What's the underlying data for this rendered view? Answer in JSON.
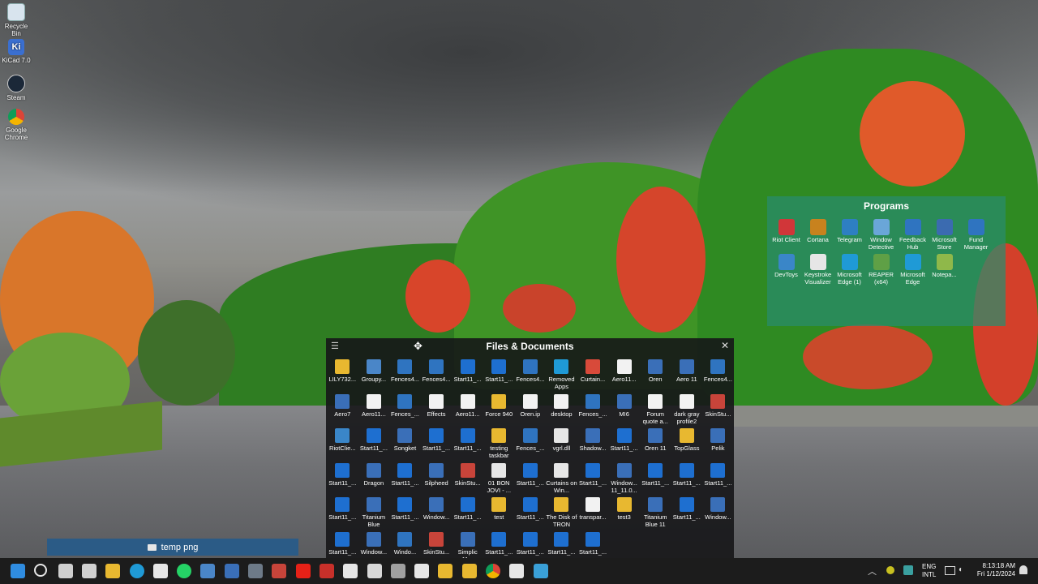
{
  "desktop_icons": [
    {
      "label": "Recycle Bin",
      "icon": "recycle-bin-icon",
      "color": "#d8e4ee"
    },
    {
      "label": "KiCad 7.0",
      "icon": "kicad-icon",
      "color": "#3a6fd0",
      "glyph": "Ki"
    },
    {
      "label": "Steam",
      "icon": "steam-icon",
      "color": "#1b2838"
    },
    {
      "label": "Google Chrome",
      "icon": "chrome-icon",
      "color": "#e0b020"
    }
  ],
  "programs": {
    "title": "Programs",
    "items": [
      {
        "label": "Riot Client",
        "color": "#d13639"
      },
      {
        "label": "Cortana",
        "color": "#c8821e"
      },
      {
        "label": "Telegram",
        "color": "#2e7fc2"
      },
      {
        "label": "Window Detective",
        "color": "#6aa6d8"
      },
      {
        "label": "Feedback Hub",
        "color": "#2f74c0"
      },
      {
        "label": "Microsoft Store",
        "color": "#3b6bb0"
      },
      {
        "label": "Fund Manager",
        "color": "#2f74c0"
      },
      {
        "label": "DevToys",
        "color": "#3a86c8"
      },
      {
        "label": "Keystroke Visualizer",
        "color": "#e6e6e6"
      },
      {
        "label": "Microsoft Edge (1)",
        "color": "#1f9ad6"
      },
      {
        "label": "REAPER (x64)",
        "color": "#5fa046"
      },
      {
        "label": "Microsoft Edge",
        "color": "#1f9ad6"
      },
      {
        "label": "Notepa...",
        "color": "#8fb84a"
      }
    ]
  },
  "files": {
    "title": "Files & Documents",
    "items": [
      {
        "label": "LILY732...",
        "color": "#e8b830"
      },
      {
        "label": "Groupy...",
        "color": "#4a86c8"
      },
      {
        "label": "Fences4...",
        "color": "#2f74c0"
      },
      {
        "label": "Fences4...",
        "color": "#2f74c0"
      },
      {
        "label": "Start11_...",
        "color": "#1e6fd0"
      },
      {
        "label": "Start11_...",
        "color": "#1e6fd0"
      },
      {
        "label": "Fences4...",
        "color": "#2f74c0"
      },
      {
        "label": "Removed Apps",
        "color": "#1f9ad6"
      },
      {
        "label": "Curtain...",
        "color": "#d84a3a"
      },
      {
        "label": "Aero11...",
        "color": "#f2f2f2"
      },
      {
        "label": "Oren",
        "color": "#3a6fb8"
      },
      {
        "label": "Aero 11",
        "color": "#3a6fb8"
      },
      {
        "label": "Fences4...",
        "color": "#2f74c0"
      },
      {
        "label": "Aero7",
        "color": "#3a6fb8"
      },
      {
        "label": "Aero11...",
        "color": "#f2f2f2"
      },
      {
        "label": "Fences_...",
        "color": "#2f74c0"
      },
      {
        "label": "Effects",
        "color": "#f2f2f2"
      },
      {
        "label": "Aero11...",
        "color": "#f2f2f2"
      },
      {
        "label": "Force 940",
        "color": "#e8b830"
      },
      {
        "label": "Oren.ip",
        "color": "#f2f2f2"
      },
      {
        "label": "desktop",
        "color": "#f2f2f2"
      },
      {
        "label": "Fences_...",
        "color": "#2f74c0"
      },
      {
        "label": "MI6",
        "color": "#3a6fb8"
      },
      {
        "label": "Forum quote a...",
        "color": "#f2f2f2"
      },
      {
        "label": "dark gray profile2",
        "color": "#f2f2f2"
      },
      {
        "label": "SkinStu...",
        "color": "#c8443a"
      },
      {
        "label": "RiotClie...",
        "color": "#3a86c8"
      },
      {
        "label": "Start11_...",
        "color": "#1e6fd0"
      },
      {
        "label": "Songket",
        "color": "#3a6fb8"
      },
      {
        "label": "Start11_...",
        "color": "#1e6fd0"
      },
      {
        "label": "Start11_...",
        "color": "#1e6fd0"
      },
      {
        "label": "testing taskbar",
        "color": "#e8b830"
      },
      {
        "label": "Fences_...",
        "color": "#2f74c0"
      },
      {
        "label": "vgrl.dll",
        "color": "#e6e6e6"
      },
      {
        "label": "Shadow...",
        "color": "#3a6fb8"
      },
      {
        "label": "Start11_...",
        "color": "#1e6fd0"
      },
      {
        "label": "Oren 11",
        "color": "#3a6fb8"
      },
      {
        "label": "TopGlass",
        "color": "#e8b830"
      },
      {
        "label": "Pelik",
        "color": "#3a6fb8"
      },
      {
        "label": "Start11_...",
        "color": "#1e6fd0"
      },
      {
        "label": "Dragon",
        "color": "#3a6fb8"
      },
      {
        "label": "Start11_...",
        "color": "#1e6fd0"
      },
      {
        "label": "Silpheed",
        "color": "#3a6fb8"
      },
      {
        "label": "SkinStu...",
        "color": "#c8443a"
      },
      {
        "label": "01 BON JOVI - ...",
        "color": "#e6e6e6"
      },
      {
        "label": "Start11_...",
        "color": "#1e6fd0"
      },
      {
        "label": "Curtains on Win...",
        "color": "#e6e6e6"
      },
      {
        "label": "Start11_...",
        "color": "#1e6fd0"
      },
      {
        "label": "Window... 11_11.0...",
        "color": "#3a6fb8"
      },
      {
        "label": "Start11_...",
        "color": "#1e6fd0"
      },
      {
        "label": "Start11_...",
        "color": "#1e6fd0"
      },
      {
        "label": "Start11_...",
        "color": "#1e6fd0"
      },
      {
        "label": "Start11_...",
        "color": "#1e6fd0"
      },
      {
        "label": "Titanium Blue",
        "color": "#3a6fb8"
      },
      {
        "label": "Start11_...",
        "color": "#1e6fd0"
      },
      {
        "label": "Window...",
        "color": "#3a6fb8"
      },
      {
        "label": "Start11_...",
        "color": "#1e6fd0"
      },
      {
        "label": "test",
        "color": "#e8b830"
      },
      {
        "label": "Start11_...",
        "color": "#1e6fd0"
      },
      {
        "label": "The Disk of TRON",
        "color": "#e8b830"
      },
      {
        "label": "transpar...",
        "color": "#f2f2f2"
      },
      {
        "label": "test3",
        "color": "#e8b830"
      },
      {
        "label": "Titanium Blue 11",
        "color": "#3a6fb8"
      },
      {
        "label": "Start11_...",
        "color": "#1e6fd0"
      },
      {
        "label": "Window...",
        "color": "#3a6fb8"
      },
      {
        "label": "Start11_...",
        "color": "#1e6fd0"
      },
      {
        "label": "Window...",
        "color": "#3a6fb8"
      },
      {
        "label": "Windo...",
        "color": "#2f74c0"
      },
      {
        "label": "SkinStu...",
        "color": "#c8443a"
      },
      {
        "label": "Simplic 11...",
        "color": "#3a6fb8"
      },
      {
        "label": "Start11_...",
        "color": "#1e6fd0"
      },
      {
        "label": "Start11_...",
        "color": "#1e6fd0"
      },
      {
        "label": "Start11_...",
        "color": "#1e6fd0"
      },
      {
        "label": "Start11_...",
        "color": "#1e6fd0"
      }
    ]
  },
  "temp_fence": {
    "label": "temp png"
  },
  "taskbar": {
    "apps": [
      {
        "icon": "start-icon",
        "color": "#2f8ce0"
      },
      {
        "icon": "search-icon",
        "color": "#e6e6e6"
      },
      {
        "icon": "task-view-icon",
        "color": "#cfcfcf"
      },
      {
        "icon": "widgets-icon",
        "color": "#d0d0d0"
      },
      {
        "icon": "file-explorer-icon",
        "color": "#e8b830"
      },
      {
        "icon": "edge-icon",
        "color": "#1f9ad6"
      },
      {
        "icon": "store-icon",
        "color": "#e6e6e6"
      },
      {
        "icon": "whatsapp-icon",
        "color": "#25d366"
      },
      {
        "icon": "groupy-icon",
        "color": "#4a86c8"
      },
      {
        "icon": "app-icon",
        "color": "#3a6fb8"
      },
      {
        "icon": "calculator-icon",
        "color": "#6d7a88"
      },
      {
        "icon": "photos-icon",
        "color": "#c8443a"
      },
      {
        "icon": "youtube-icon",
        "color": "#e62117"
      },
      {
        "icon": "pdf-icon",
        "color": "#c8302a"
      },
      {
        "icon": "window-icon",
        "color": "#e6e6e6"
      },
      {
        "icon": "shield-icon",
        "color": "#d8d8d8"
      },
      {
        "icon": "settings-icon",
        "color": "#a0a0a0"
      },
      {
        "icon": "fences-icon",
        "color": "#e6e6e6"
      },
      {
        "icon": "folder-icon",
        "color": "#e8b830"
      },
      {
        "icon": "folder-icon",
        "color": "#e8b830"
      },
      {
        "icon": "chrome-icon",
        "color": "#e0b020"
      },
      {
        "icon": "window-icon",
        "color": "#e6e6e6"
      },
      {
        "icon": "app-icon",
        "color": "#3aa0d8"
      }
    ],
    "tray": {
      "lang_top": "ENG",
      "lang_bottom": "INTL",
      "time": "8:13:18 AM",
      "date": "Fri 1/12/2024"
    }
  }
}
